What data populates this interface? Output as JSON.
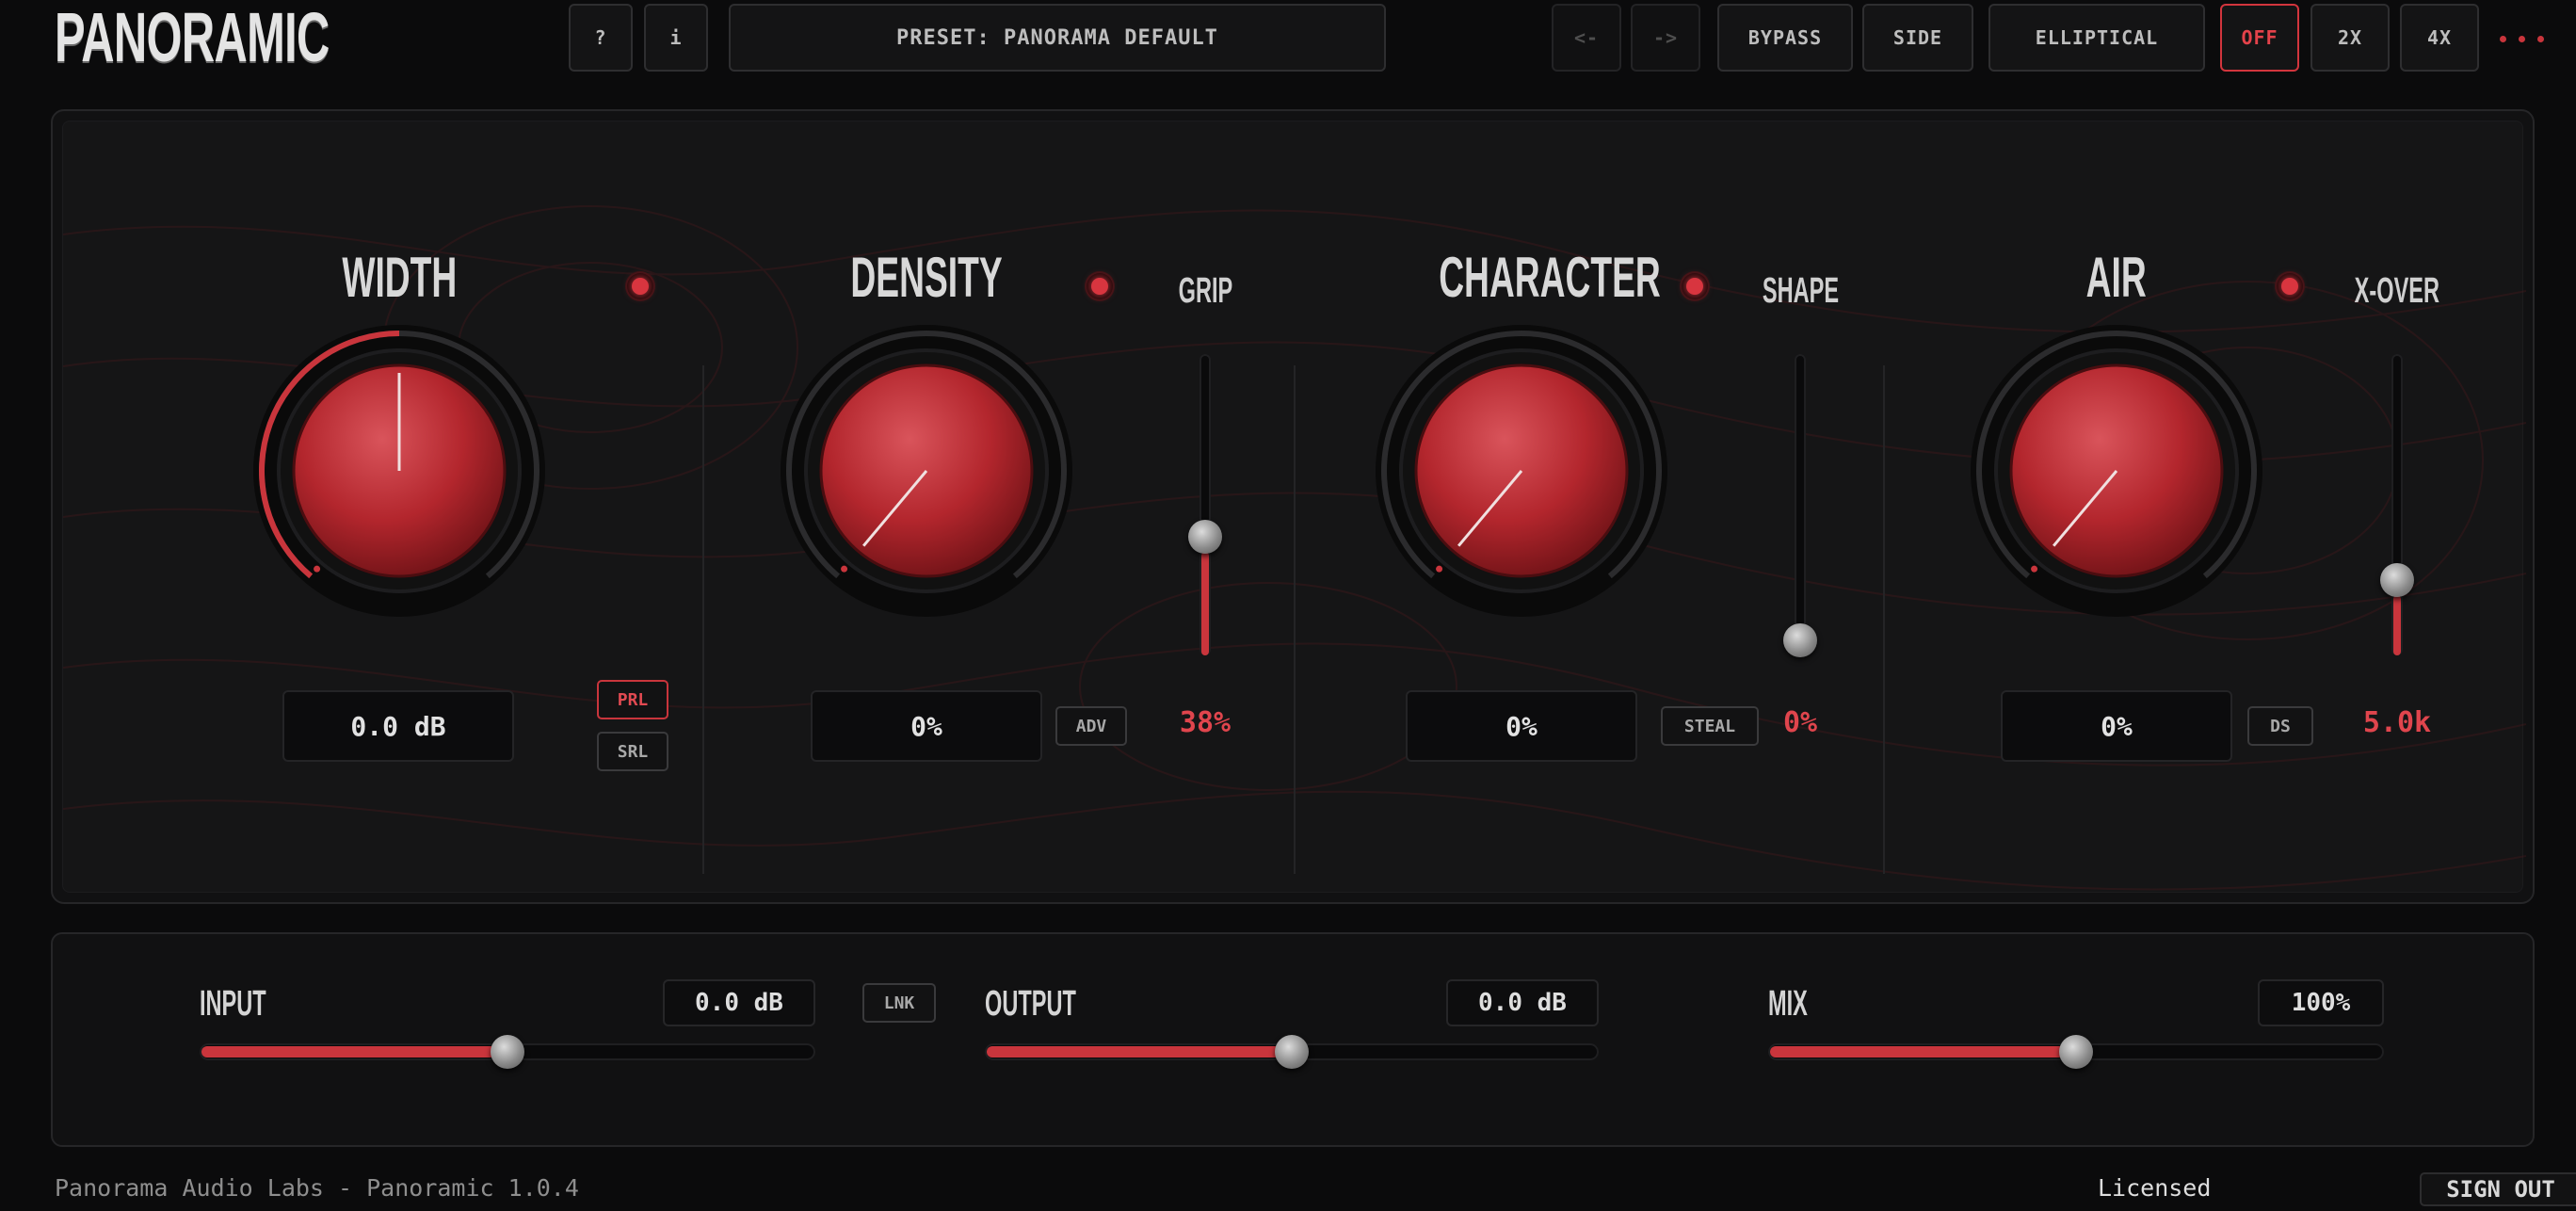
{
  "app": {
    "logo": "PANORAMIC"
  },
  "toolbar": {
    "help_label": "?",
    "info_label": "i",
    "preset_label": "PRESET: PANORAMA DEFAULT",
    "undo_label": "<-",
    "redo_label": "->",
    "bypass_label": "BYPASS",
    "side_label": "SIDE",
    "elliptical_label": "ELLIPTICAL",
    "off_label": "OFF",
    "x2_label": "2X",
    "x4_label": "4X",
    "menu_icon": "more-dots-icon"
  },
  "sections": {
    "width": {
      "title": "WIDTH",
      "value": "0.0 dB",
      "prl_label": "PRL",
      "srl_label": "SRL",
      "knob_fraction": 0.5
    },
    "density": {
      "title": "DENSITY",
      "value": "0%",
      "adv_label": "ADV",
      "side_title": "GRIP",
      "side_value": "38%",
      "side_fraction": 0.38,
      "knob_fraction": 0.0
    },
    "character": {
      "title": "CHARACTER",
      "value": "0%",
      "steal_label": "STEAL",
      "side_title": "SHAPE",
      "side_value": "0%",
      "side_fraction": 0.0,
      "knob_fraction": 0.0
    },
    "air": {
      "title": "AIR",
      "value": "0%",
      "ds_label": "DS",
      "side_title": "X-OVER",
      "side_value": "5.0k",
      "side_fraction": 0.22,
      "knob_fraction": 0.0
    }
  },
  "bottom": {
    "input": {
      "label": "INPUT",
      "value": "0.0 dB",
      "fraction": 0.5
    },
    "link_label": "LNK",
    "output": {
      "label": "OUTPUT",
      "value": "0.0 dB",
      "fraction": 0.5
    },
    "mix": {
      "label": "MIX",
      "value": "100%",
      "fraction": 0.5
    }
  },
  "footer": {
    "version_text": "Panorama Audio Labs - Panoramic 1.0.4",
    "status_text": "Licensed",
    "signout_label": "SIGN OUT"
  },
  "colors": {
    "accent": "#c9353c",
    "background": "#0b0b0c"
  }
}
